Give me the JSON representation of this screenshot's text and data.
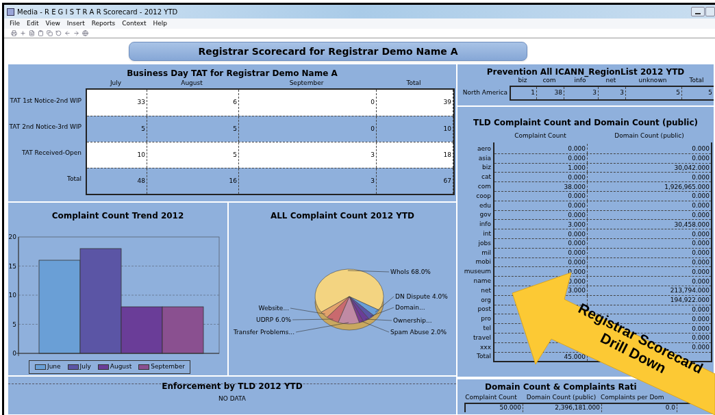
{
  "window": {
    "title": "Media - R E G I S T R A R Scorecard - 2012 YTD"
  },
  "menu": [
    "File",
    "Edit",
    "View",
    "Insert",
    "Reports",
    "Context",
    "Help"
  ],
  "banner": {
    "title": "Registrar Scorecard for Registrar Demo Name A"
  },
  "tat_table": {
    "title": "Business Day TAT for Registrar Demo Name A",
    "columns": [
      "July",
      "August",
      "September",
      "Total"
    ],
    "rows": [
      {
        "label": "TAT 1st Notice-2nd WIP",
        "values": [
          "33",
          "6",
          "0",
          "39"
        ]
      },
      {
        "label": "TAT 2nd Notice-3rd WIP",
        "values": [
          "5",
          "5",
          "0",
          "10"
        ]
      },
      {
        "label": "TAT Received-Open",
        "values": [
          "10",
          "5",
          "3",
          "18"
        ]
      },
      {
        "label": "Total",
        "values": [
          "48",
          "16",
          "3",
          "67"
        ]
      }
    ]
  },
  "trend_chart": {
    "title": "Complaint Count Trend 2012",
    "chart_data": {
      "type": "bar",
      "grid": true,
      "ylim": [
        0,
        20
      ],
      "yticks": [
        0,
        5,
        10,
        15,
        20
      ],
      "series": [
        {
          "name": "June",
          "color": "#6a9fd6",
          "values": [
            16
          ]
        },
        {
          "name": "July",
          "color": "#5b55a5",
          "values": [
            18
          ]
        },
        {
          "name": "August",
          "color": "#6a3d98",
          "values": [
            8
          ]
        },
        {
          "name": "September",
          "color": "#8a5090",
          "values": [
            8
          ]
        }
      ]
    }
  },
  "pie_chart": {
    "title": "ALL Complaint Count 2012 YTD",
    "labels": [
      "WhoIs 68.0%",
      "DN Dispute 4.0%",
      "Website...",
      "Domain...",
      "UDRP 6.0%",
      "Ownership...",
      "Transfer Problems...",
      "Spam Abuse 2.0%"
    ]
  },
  "enforcement": {
    "title": "Enforcement by TLD 2012 YTD",
    "message": "NO DATA"
  },
  "prevention": {
    "title": "Prevention All ICANN_RegionList 2012 YTD",
    "columns": [
      "biz",
      "com",
      "info",
      "net",
      "unknown",
      "Total"
    ],
    "rows": [
      {
        "label": "North America",
        "values": [
          "1",
          "38",
          "3",
          "3",
          "5",
          "5"
        ]
      }
    ]
  },
  "tld_table": {
    "title": "TLD Complaint Count and Domain Count (public)",
    "columns": [
      "Complaint Count",
      "Domain Count (public)"
    ],
    "rows": [
      {
        "label": "aero",
        "complaint": "0.000",
        "domain": "0.000"
      },
      {
        "label": "asia",
        "complaint": "0.000",
        "domain": "0.000"
      },
      {
        "label": "biz",
        "complaint": "1.000",
        "domain": "30,042.000"
      },
      {
        "label": "cat",
        "complaint": "0.000",
        "domain": "0.000"
      },
      {
        "label": "com",
        "complaint": "38.000",
        "domain": "1,926,965.000"
      },
      {
        "label": "coop",
        "complaint": "0.000",
        "domain": "0.000"
      },
      {
        "label": "edu",
        "complaint": "0.000",
        "domain": "0.000"
      },
      {
        "label": "gov",
        "complaint": "0.000",
        "domain": "0.000"
      },
      {
        "label": "info",
        "complaint": "3.000",
        "domain": "30,458.000"
      },
      {
        "label": "int",
        "complaint": "0.000",
        "domain": "0.000"
      },
      {
        "label": "jobs",
        "complaint": "0.000",
        "domain": "0.000"
      },
      {
        "label": "mil",
        "complaint": "0.000",
        "domain": "0.000"
      },
      {
        "label": "mobi",
        "complaint": "0.000",
        "domain": "0.000"
      },
      {
        "label": "museum",
        "complaint": "0.000",
        "domain": "0.000"
      },
      {
        "label": "name",
        "complaint": "0.000",
        "domain": "0.000"
      },
      {
        "label": "net",
        "complaint": "3.000",
        "domain": "213,794.000"
      },
      {
        "label": "org",
        "domain": "194,922.000"
      },
      {
        "label": "post",
        "domain": "0.000"
      },
      {
        "label": "pro",
        "domain": "0.000"
      },
      {
        "label": "tel",
        "domain": "0.000"
      },
      {
        "label": "travel",
        "domain": "0.000"
      },
      {
        "label": "xxx",
        "domain": "0.000"
      },
      {
        "label": "Total",
        "complaint": "45.000"
      }
    ]
  },
  "ratio": {
    "title": "Domain Count & Complaints Rati",
    "columns": [
      "Complaint Count",
      "Domain Count (public)",
      "Complaints per Dom"
    ],
    "rows": [
      {
        "values": [
          "50.000",
          "2,396,181.000",
          "0.0"
        ]
      }
    ]
  },
  "callout": {
    "lines": [
      "Registrar Scorecard",
      "Drill Down"
    ]
  }
}
